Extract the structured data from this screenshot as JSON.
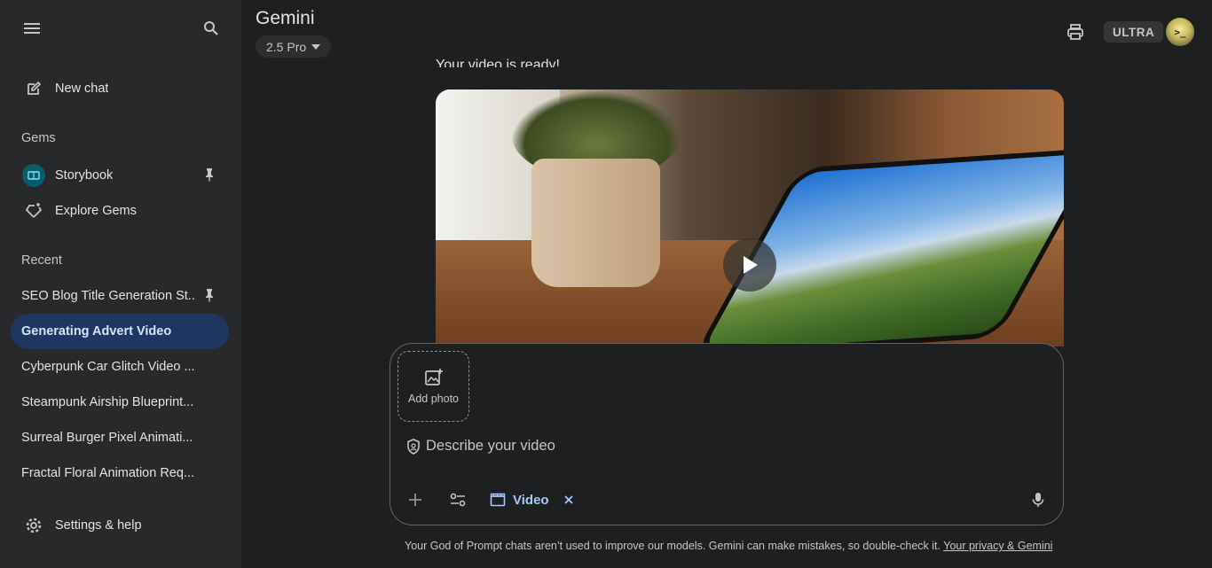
{
  "sidebar": {
    "new_chat": "New chat",
    "gems_heading": "Gems",
    "gems": [
      {
        "label": "Storybook",
        "pinned": true
      },
      {
        "label": "Explore Gems"
      }
    ],
    "recent_heading": "Recent",
    "recent": [
      {
        "label": "SEO Blog Title Generation St...",
        "pinned": true
      },
      {
        "label": "Generating Advert Video",
        "active": true
      },
      {
        "label": "Cyberpunk Car Glitch Video ..."
      },
      {
        "label": "Steampunk Airship Blueprint..."
      },
      {
        "label": "Surreal Burger Pixel Animati..."
      },
      {
        "label": "Fractal Floral Animation Req..."
      }
    ],
    "settings": "Settings & help"
  },
  "header": {
    "title": "Gemini",
    "model": "2.5 Pro",
    "plan_badge": "ULTRA",
    "avatar_text": ">_"
  },
  "chat": {
    "message": "Your video is ready!"
  },
  "composer": {
    "add_photo": "Add photo",
    "placeholder": "Describe your video",
    "chip_label": "Video"
  },
  "footer": {
    "text": "Your God of Prompt chats aren’t used to improve our models. Gemini can make mistakes, so double-check it.",
    "link": "Your privacy & Gemini"
  },
  "colors": {
    "sidebar_bg": "#28292a",
    "page_bg": "#1e1f20",
    "active_item_bg": "#1f3760",
    "accent": "#a8c7fa"
  }
}
